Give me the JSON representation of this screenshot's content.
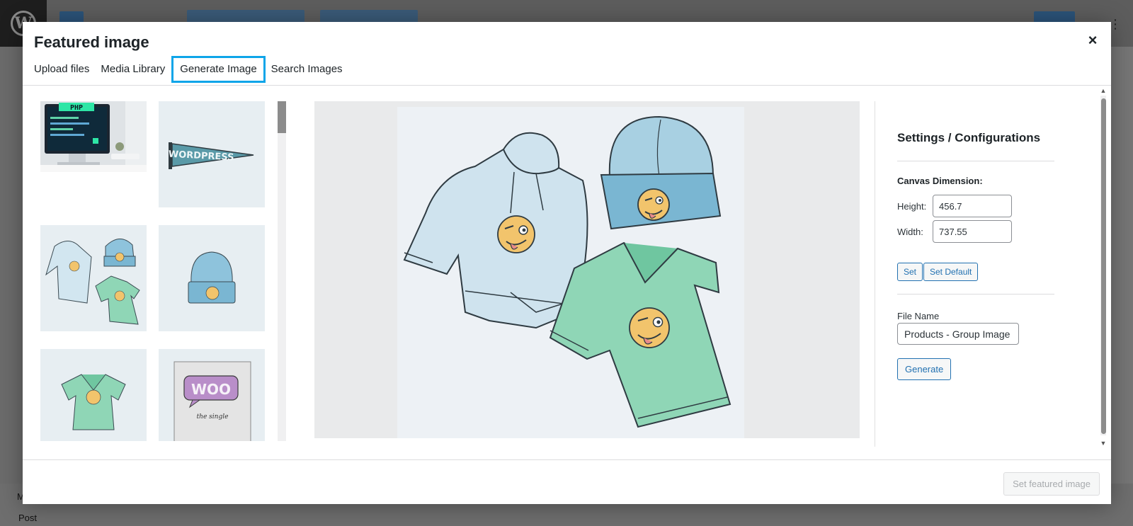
{
  "background": {
    "post_label": "Post",
    "m_label": "M"
  },
  "modal": {
    "title": "Featured image",
    "close_symbol": "×"
  },
  "tabs": [
    {
      "label": "Upload files",
      "active": false
    },
    {
      "label": "Media Library",
      "active": false
    },
    {
      "label": "Generate Image",
      "active": true
    },
    {
      "label": "Search Images",
      "active": false
    }
  ],
  "thumbnails": {
    "php_text": "PHP",
    "wordpress_text": "WORDPRESS",
    "woo_text": "WOO",
    "woo_sub": "the single"
  },
  "settings": {
    "title": "Settings / Configurations",
    "canvas_label": "Canvas Dimension:",
    "height_label": "Height:",
    "height_value": "456.7",
    "width_label": "Width:",
    "width_value": "737.55",
    "set_label": "Set",
    "set_default_label": "Set Default",
    "file_name_label": "File Name",
    "file_name_value": "Products - Group Image",
    "generate_label": "Generate"
  },
  "footer": {
    "set_featured_label": "Set featured image"
  },
  "icons": {
    "close": "close-icon",
    "logo": "wordpress-logo-icon"
  },
  "colors": {
    "active_tab_border": "#0ea5e9",
    "button_blue": "#2271b1",
    "hoodie": "#cfe3ee",
    "beanie": "#8ec3dc",
    "tshirt": "#8fd6b6",
    "emoji": "#f2c46c"
  }
}
